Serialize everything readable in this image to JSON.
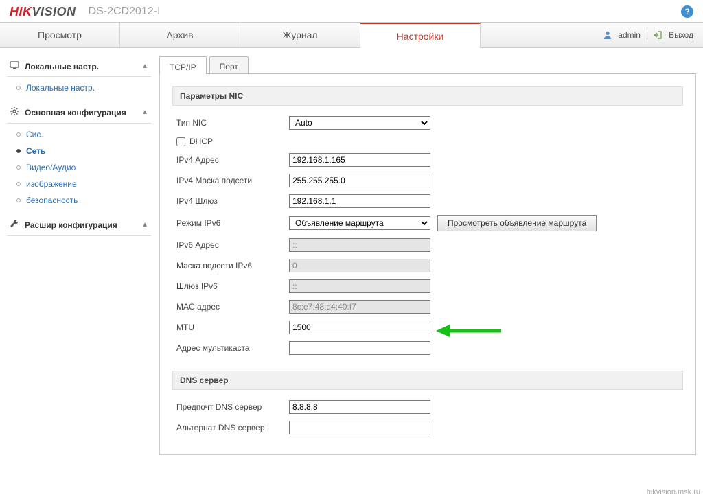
{
  "brand": {
    "logo_red": "HIK",
    "logo_gray": "VISION",
    "model": "DS-2CD2012-I"
  },
  "nav": {
    "tabs": [
      "Просмотр",
      "Архив",
      "Журнал",
      "Настройки"
    ],
    "active_index": 3,
    "user": "admin",
    "logout": "Выход"
  },
  "sidebar": {
    "groups": [
      {
        "title": "Локальные настр.",
        "icon": "monitor",
        "items": [
          {
            "label": "Локальные настр.",
            "active": false
          }
        ]
      },
      {
        "title": "Основная конфигурация",
        "icon": "gear",
        "items": [
          {
            "label": "Сис.",
            "active": false
          },
          {
            "label": "Сеть",
            "active": true
          },
          {
            "label": "Видео/Аудио",
            "active": false
          },
          {
            "label": "изображение",
            "active": false
          },
          {
            "label": "безопасность",
            "active": false
          }
        ]
      },
      {
        "title": "Расшир конфигурация",
        "icon": "wrench",
        "items": []
      }
    ]
  },
  "subtabs": {
    "items": [
      "TCP/IP",
      "Порт"
    ],
    "active_index": 0
  },
  "nic_section": {
    "title": "Параметры NIC",
    "nic_type_label": "Тип NIC",
    "nic_type_value": "Auto",
    "dhcp_label": "DHCP",
    "dhcp_checked": false,
    "ipv4_addr_label": "IPv4 Адрес",
    "ipv4_addr_value": "192.168.1.165",
    "ipv4_mask_label": "IPv4 Маска подсети",
    "ipv4_mask_value": "255.255.255.0",
    "ipv4_gw_label": "IPv4 Шлюз",
    "ipv4_gw_value": "192.168.1.1",
    "ipv6_mode_label": "Режим IPv6",
    "ipv6_mode_value": "Объявление маршрута",
    "ipv6_view_btn": "Просмотреть объявление маршрута",
    "ipv6_addr_label": "IPv6 Адрес",
    "ipv6_addr_value": "::",
    "ipv6_mask_label": "Маска подсети IPv6",
    "ipv6_mask_value": "0",
    "ipv6_gw_label": "Шлюз IPv6",
    "ipv6_gw_value": "::",
    "mac_label": "MAC адрес",
    "mac_value": "8c:e7:48:d4:40:f7",
    "mtu_label": "MTU",
    "mtu_value": "1500",
    "multicast_label": "Адрес мультикаста",
    "multicast_value": ""
  },
  "dns_section": {
    "title": "DNS сервер",
    "pref_label": "Предпочт DNS сервер",
    "pref_value": "8.8.8.8",
    "alt_label": "Альтернат DNS сервер",
    "alt_value": ""
  },
  "footer": {
    "watermark": "hikvision.msk.ru"
  }
}
